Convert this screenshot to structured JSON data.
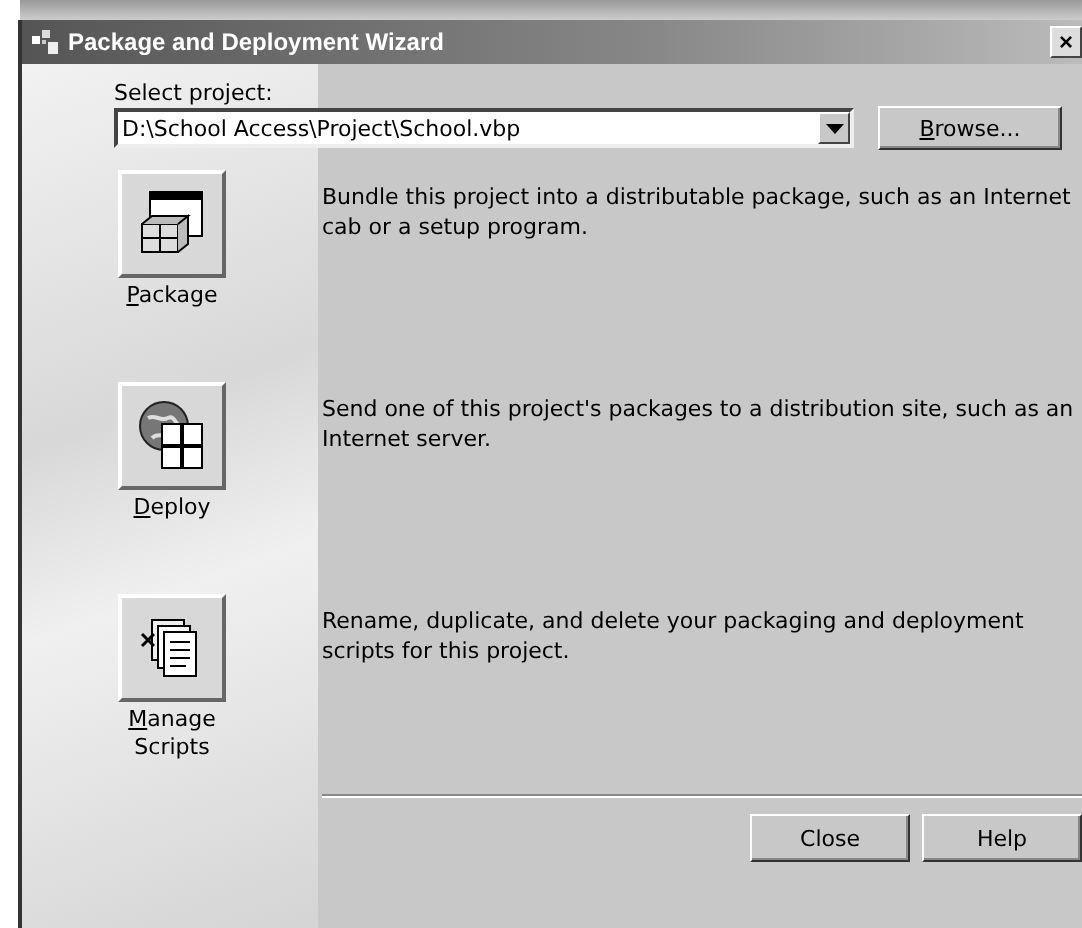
{
  "window": {
    "title": "Package and Deployment Wizard",
    "close_glyph": "×"
  },
  "project": {
    "label": "Select project:",
    "value": "D:\\School Access\\Project\\School.vbp",
    "browse": "Browse..."
  },
  "actions": [
    {
      "kind": "package",
      "label": "Package",
      "description": "Bundle this project into a distributable package, such as an Internet cab or a setup program."
    },
    {
      "kind": "deploy",
      "label": "Deploy",
      "description": "Send one of this project's packages to a distribution site, such as an Internet server."
    },
    {
      "kind": "scripts",
      "label": "Manage Scripts",
      "description": "Rename, duplicate, and delete your packaging and deployment scripts for this project."
    }
  ],
  "buttons": [
    "Close",
    "Help"
  ]
}
